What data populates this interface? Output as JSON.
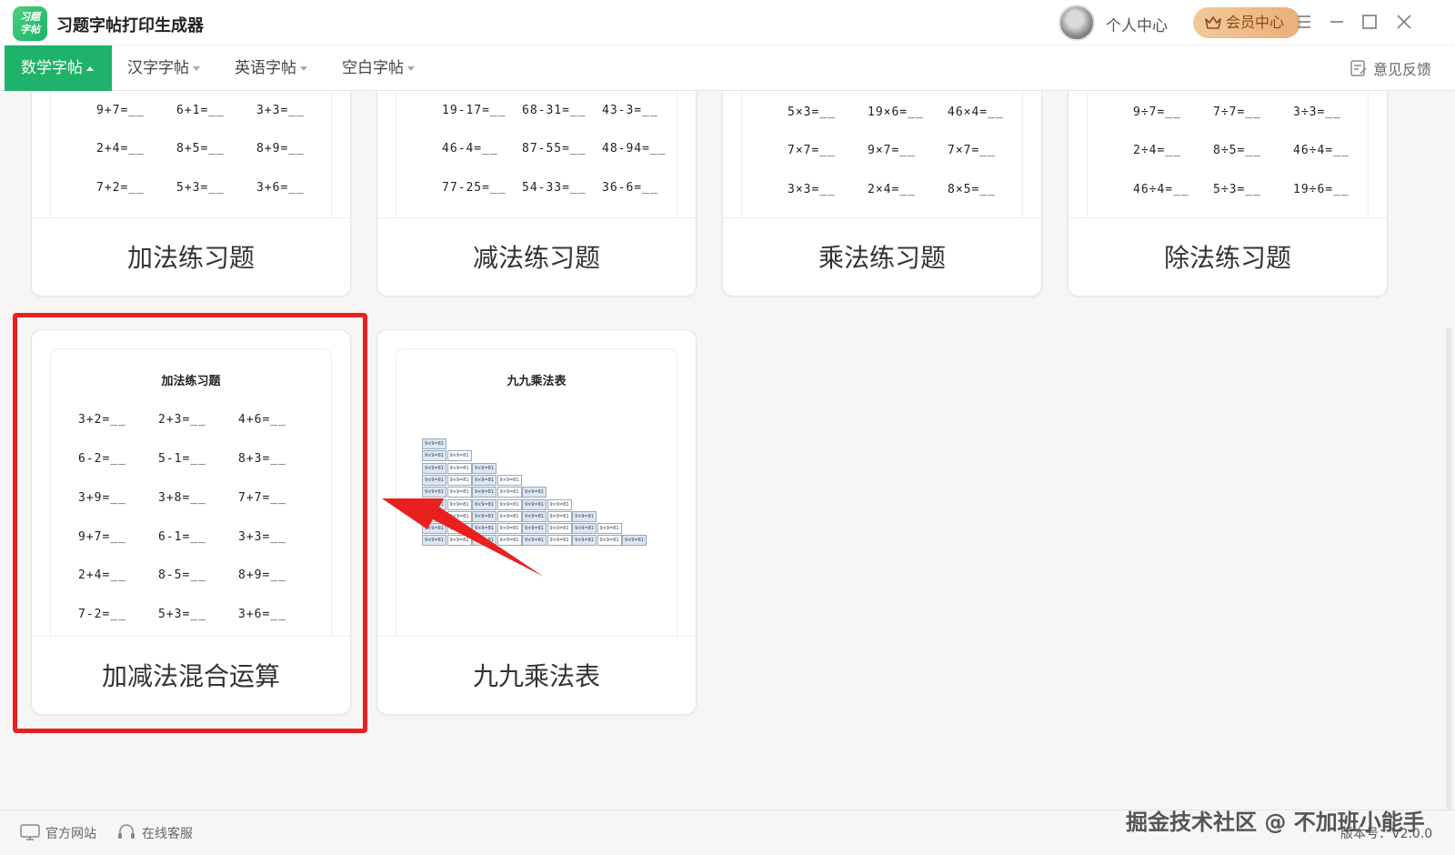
{
  "app": {
    "logo_text": "习题\n字帖",
    "title": "习题字帖打印生成器"
  },
  "header": {
    "personal_center": "个人中心",
    "vip_center": "会员中心"
  },
  "menu": {
    "items": [
      {
        "label": "数学字帖"
      },
      {
        "label": "汉字字帖"
      },
      {
        "label": "英语字帖"
      },
      {
        "label": "空白字帖"
      }
    ],
    "feedback": "意见反馈"
  },
  "cards": [
    {
      "label": "加法练习题",
      "problems": [
        [
          "9+7=__",
          "6+1=__",
          "3+3=__"
        ],
        [
          "2+4=__",
          "8+5=__",
          "8+9=__"
        ],
        [
          "7+2=__",
          "5+3=__",
          "3+6=__"
        ]
      ]
    },
    {
      "label": "减法练习题",
      "problems": [
        [
          "19-17=__",
          "68-31=__",
          "43-3=__"
        ],
        [
          "46-4=__",
          "87-55=__",
          "48-94=__"
        ],
        [
          "77-25=__",
          "54-33=__",
          "36-6=__"
        ]
      ]
    },
    {
      "label": "乘法练习题",
      "problems": [
        [
          "5×3=__",
          "19×6=__",
          "46×4=__"
        ],
        [
          "7×7=__",
          "9×7=__",
          "7×7=__"
        ],
        [
          "3×3=__",
          "2×4=__",
          "8×5=__"
        ]
      ]
    },
    {
      "label": "除法练习题",
      "problems": [
        [
          "9÷7=__",
          "7÷7=__",
          "3÷3=__"
        ],
        [
          "2÷4=__",
          "8÷5=__",
          "46÷4=__"
        ],
        [
          "46÷4=__",
          "5÷3=__",
          "19÷6=__"
        ]
      ]
    },
    {
      "label": "加减法混合运算",
      "sheet_title": "加法练习题",
      "problems": [
        [
          "3+2=__",
          "2+3=__",
          "4+6=__"
        ],
        [
          "6-2=__",
          "5-1=__",
          "8+3=__"
        ],
        [
          "3+9=__",
          "3+8=__",
          "7+7=__"
        ],
        [
          "9+7=__",
          "6-1=__",
          "3+3=__"
        ],
        [
          "2+4=__",
          "8-5=__",
          "8+9=__"
        ],
        [
          "7-2=__",
          "5+3=__",
          "3+6=__"
        ]
      ]
    },
    {
      "label": "九九乘法表",
      "sheet_title": "九九乘法表",
      "cell_text": "9×9=81"
    }
  ],
  "status": {
    "website": "官方网站",
    "service": "在线客服",
    "watermark": "掘金技术社区 @ 不加班小能手",
    "version": "版本号：V2.0.0"
  },
  "colors": {
    "accent": "#1fb26a",
    "highlight": "#e8201f",
    "vip": "#e9b07a"
  },
  "icons": [
    "crown-icon",
    "menu-icon",
    "minimize-icon",
    "maximize-icon",
    "close-icon",
    "feedback-icon",
    "monitor-icon",
    "headset-icon"
  ]
}
